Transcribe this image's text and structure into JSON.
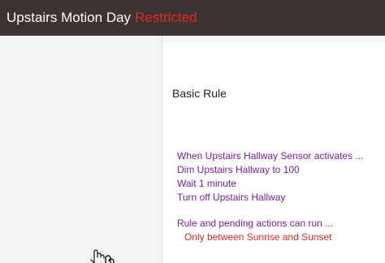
{
  "header": {
    "title": "Upstairs Motion Day",
    "status": "Restricted",
    "bg_color": "#3d3432",
    "status_color": "#e8262a"
  },
  "rule": {
    "heading": "Basic Rule",
    "lines": [
      "When Upstairs Hallway Sensor activates ...",
      "Dim Upstairs Hallway to 100",
      "Wait 1 minute",
      "Turn off Upstairs Hallway"
    ],
    "run_condition": "Rule and pending actions can run ...",
    "restriction": "Only between Sunrise and Sunset",
    "text_color": "#7b1f9c",
    "restriction_color": "#e8262a"
  },
  "cursor": {
    "icon": "hand-pointer-icon"
  }
}
